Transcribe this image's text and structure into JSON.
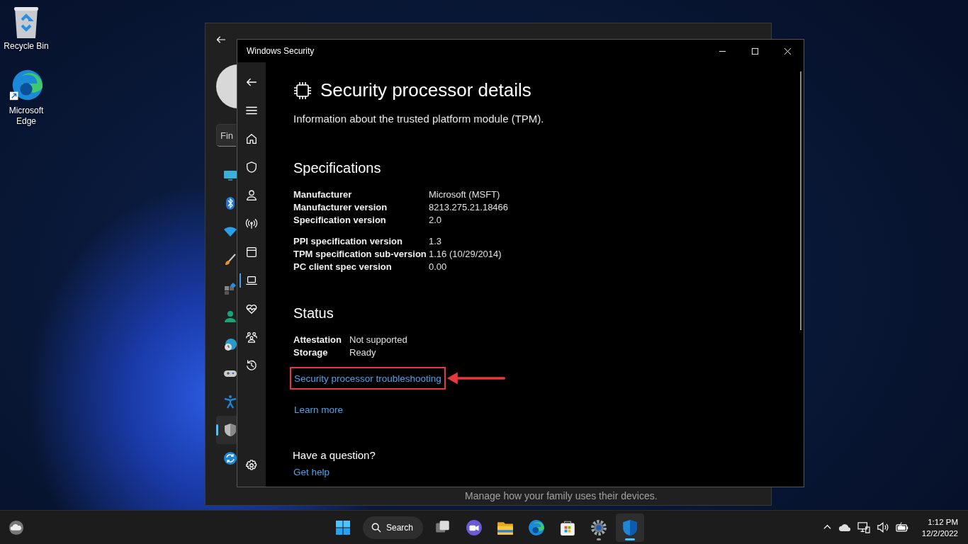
{
  "desktop_icons": [
    {
      "kind": "recycle",
      "label": "Recycle Bin"
    },
    {
      "kind": "edge",
      "label": "Microsoft Edge"
    }
  ],
  "settings_window": {
    "search": {
      "placeholder": "Fin"
    },
    "nav_items": [
      {
        "kind": "monitor",
        "selected": false
      },
      {
        "kind": "bluetooth",
        "selected": false
      },
      {
        "kind": "wifi",
        "selected": false
      },
      {
        "kind": "brush",
        "selected": false
      },
      {
        "kind": "apps",
        "selected": false
      },
      {
        "kind": "person",
        "selected": false
      },
      {
        "kind": "globe",
        "selected": false
      },
      {
        "kind": "gamepad",
        "selected": false
      },
      {
        "kind": "accessibility",
        "selected": false
      },
      {
        "kind": "shield",
        "selected": true
      },
      {
        "kind": "sync",
        "selected": false
      }
    ],
    "footer_text": "Manage how your family uses their devices."
  },
  "security_window": {
    "title": "Windows Security",
    "sidebar": {
      "items": [
        {
          "kind": "home",
          "selected": false
        },
        {
          "kind": "shield",
          "selected": false
        },
        {
          "kind": "account",
          "selected": false
        },
        {
          "kind": "network",
          "selected": false
        },
        {
          "kind": "app",
          "selected": false
        },
        {
          "kind": "device",
          "selected": true
        },
        {
          "kind": "health",
          "selected": false
        },
        {
          "kind": "family",
          "selected": false
        },
        {
          "kind": "history",
          "selected": false
        }
      ]
    },
    "heading": "Security processor details",
    "subtitle": "Information about the trusted platform module (TPM).",
    "specifications": {
      "title": "Specifications",
      "groups": [
        [
          {
            "label": "Manufacturer",
            "value": "Microsoft (MSFT)"
          },
          {
            "label": "Manufacturer version",
            "value": "8213.275.21.18466"
          },
          {
            "label": "Specification version",
            "value": "2.0"
          }
        ],
        [
          {
            "label": "PPI specification version",
            "value": "1.3"
          },
          {
            "label": "TPM specification sub-version",
            "value": "1.16 (10/29/2014)"
          },
          {
            "label": "PC client spec version",
            "value": "0.00"
          }
        ]
      ]
    },
    "status": {
      "title": "Status",
      "rows": [
        {
          "label": "Attestation",
          "value": "Not supported"
        },
        {
          "label": "Storage",
          "value": "Ready"
        }
      ]
    },
    "links": [
      {
        "label": "Security processor troubleshooting",
        "highlighted": true
      },
      {
        "label": "Learn more",
        "highlighted": false
      }
    ],
    "question": {
      "title": "Have a question?",
      "link": "Get help"
    }
  },
  "taskbar": {
    "search_label": "Search",
    "apps": [
      {
        "kind": "taskview",
        "running": false,
        "selected": false
      },
      {
        "kind": "chat",
        "running": false,
        "selected": false
      },
      {
        "kind": "folder",
        "running": false,
        "selected": false
      },
      {
        "kind": "edge",
        "running": false,
        "selected": false
      },
      {
        "kind": "store",
        "running": false,
        "selected": false
      },
      {
        "kind": "gear",
        "running": true,
        "selected": false
      },
      {
        "kind": "shield",
        "running": true,
        "selected": true
      }
    ],
    "time": "1:12 PM",
    "date": "12/2/2022"
  }
}
